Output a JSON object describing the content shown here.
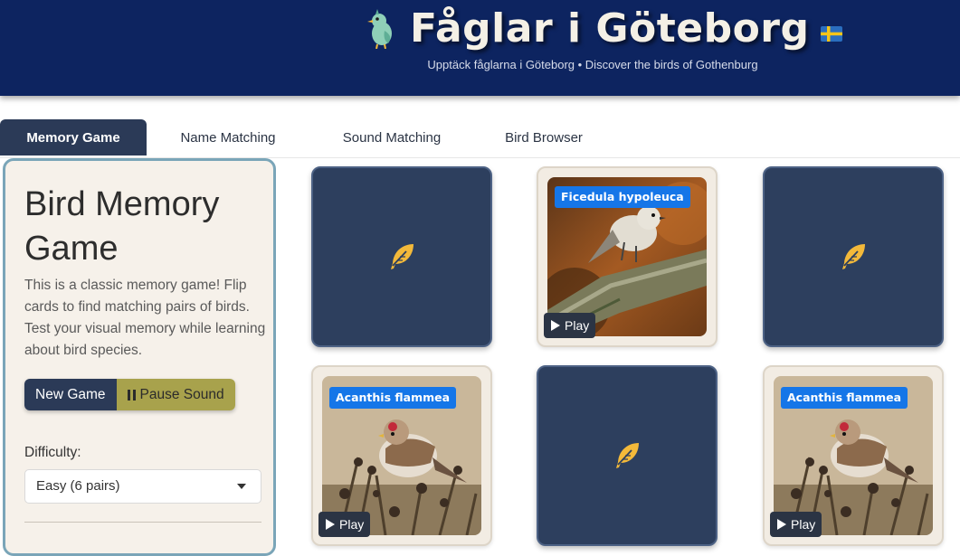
{
  "header": {
    "title": "Fåglar i Göteborg",
    "subtitle": "Upptäck fåglarna i Göteborg • Discover the birds of Gothenburg",
    "logo_icon": "bird-icon",
    "flag_icon": "swedish-flag-icon"
  },
  "tabs": [
    {
      "label": "Memory Game",
      "active": true
    },
    {
      "label": "Name Matching",
      "active": false
    },
    {
      "label": "Sound Matching",
      "active": false
    },
    {
      "label": "Bird Browser",
      "active": false
    }
  ],
  "sidebar": {
    "title": "Bird Memory Game",
    "description": "This is a classic memory game! Flip cards to find matching pairs of birds. Test your visual memory while learning about bird species.",
    "new_game_label": "New Game",
    "pause_label": "Pause Sound",
    "difficulty_label": "Difficulty:",
    "difficulty_value": "Easy (6 pairs)"
  },
  "cards": [
    {
      "state": "face-down",
      "icon": "feather-icon"
    },
    {
      "state": "face-up",
      "species": "Ficedula hypoleuca",
      "play_label": "Play"
    },
    {
      "state": "face-down",
      "icon": "feather-icon"
    },
    {
      "state": "face-up",
      "species": "Acanthis flammea",
      "play_label": "Play"
    },
    {
      "state": "face-down",
      "icon": "feather-icon"
    },
    {
      "state": "face-up",
      "species": "Acanthis flammea",
      "play_label": "Play"
    }
  ],
  "colors": {
    "header_bg": "#0d2460",
    "tab_active_bg": "#2b3a57",
    "card_back": "#2d3f5e",
    "feather": "#f3b93a",
    "badge": "#1576e8",
    "pause_button": "#a8a24c"
  }
}
